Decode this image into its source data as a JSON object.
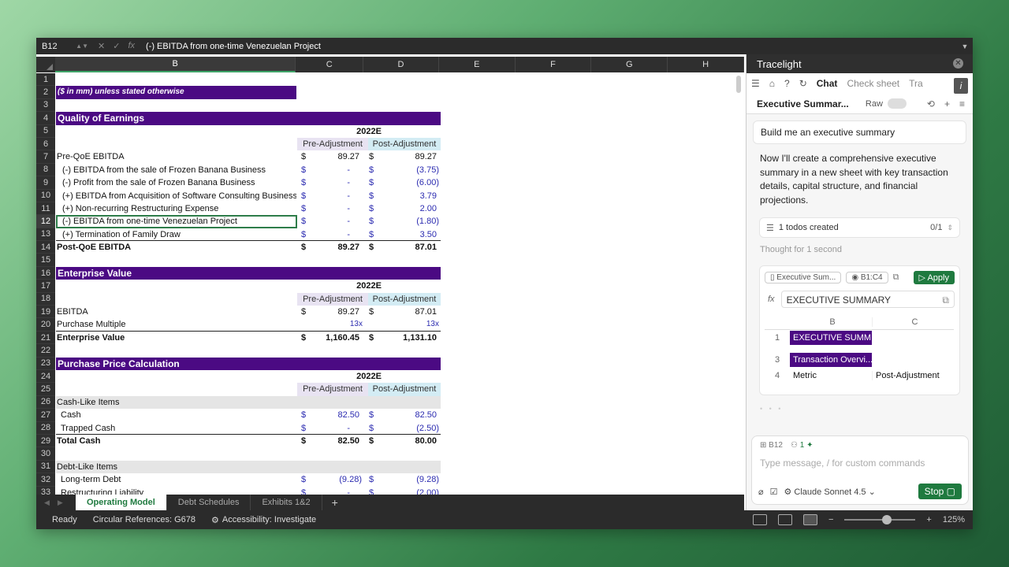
{
  "formula_bar": {
    "name_box": "B12",
    "fx": "fx",
    "formula": "(-) EBITDA from one-time Venezuelan Project"
  },
  "columns": [
    "B",
    "C",
    "D",
    "E",
    "F",
    "G",
    "H"
  ],
  "rows": {
    "r2": "($ in mm) unless stated otherwise",
    "r4": "Quality of Earnings",
    "r5_year": "2022E",
    "r6_pre": "Pre-Adjustment",
    "r6_post": "Post-Adjustment",
    "r7": [
      "Pre-QoE EBITDA",
      "$",
      "89.27",
      "$",
      "89.27"
    ],
    "r8": [
      "(-) EBITDA from the sale of Frozen Banana Business",
      "$",
      "-",
      "$",
      "(3.75)"
    ],
    "r9": [
      "(-) Profit from the sale of Frozen Banana Business",
      "$",
      "-",
      "$",
      "(6.00)"
    ],
    "r10": [
      "(+) EBITDA from Acquisition of Software Consulting Business",
      "$",
      "-",
      "$",
      "3.79"
    ],
    "r11": [
      "(+) Non-recurring Restructuring Expense",
      "$",
      "-",
      "$",
      "2.00"
    ],
    "r12": [
      "(-) EBITDA from one-time Venezuelan Project",
      "$",
      "-",
      "$",
      "(1.80)"
    ],
    "r13": [
      "(+) Termination of Family Draw",
      "$",
      "-",
      "$",
      "3.50"
    ],
    "r14": [
      "Post-QoE EBITDA",
      "$",
      "89.27",
      "$",
      "87.01"
    ],
    "r16": "Enterprise Value",
    "r17_year": "2022E",
    "r18_pre": "Pre-Adjustment",
    "r18_post": "Post-Adjustment",
    "r19": [
      "EBITDA",
      "$",
      "89.27",
      "$",
      "87.01"
    ],
    "r20": [
      "Purchase Multiple",
      "13x",
      "13x"
    ],
    "r21": [
      "Enterprise Value",
      "$",
      "1,160.45",
      "$",
      "1,131.10"
    ],
    "r23": "Purchase Price Calculation",
    "r24_year": "2022E",
    "r25_pre": "Pre-Adjustment",
    "r25_post": "Post-Adjustment",
    "r26": "Cash-Like Items",
    "r27": [
      "Cash",
      "$",
      "82.50",
      "$",
      "82.50"
    ],
    "r28": [
      "Trapped Cash",
      "$",
      "-",
      "$",
      "(2.50)"
    ],
    "r29": [
      "Total Cash",
      "$",
      "82.50",
      "$",
      "80.00"
    ],
    "r31": "Debt-Like Items",
    "r32": [
      "Long-term Debt",
      "$",
      "(9.28)",
      "$",
      "(9.28)"
    ],
    "r33": [
      "Restructuring Liability",
      "$",
      "-",
      "$",
      "(2.00)"
    ]
  },
  "tabs": [
    "Operating Model",
    "Debt Schedules",
    "Exhibits 1&2"
  ],
  "tab_add": "+",
  "status": {
    "ready": "Ready",
    "circular": "Circular References: G678",
    "accessibility": "Accessibility: Investigate",
    "zoom": "125%"
  },
  "panel": {
    "title": "Tracelight",
    "tabs": [
      "Chat",
      "Check sheet",
      "Tra"
    ],
    "conversation_title": "Executive Summar...",
    "raw_label": "Raw",
    "user_message": "Build me an executive summary",
    "assistant_message": "Now I'll create a comprehensive executive summary in a new sheet with key transaction details, capital structure, and financial projections.",
    "todos_label": "1 todos created",
    "todos_count": "0/1",
    "thought": "Thought for 1 second",
    "card": {
      "sheet_chip": "Executive Sum...",
      "range_chip": "B1:C4",
      "apply": "Apply",
      "fx_label": "fx",
      "fx_value": "EXECUTIVE SUMMARY",
      "col_b": "B",
      "col_c": "C",
      "rows": [
        {
          "n": "1",
          "b": "EXECUTIVE SUMM...",
          "c": ""
        },
        {
          "n": "3",
          "b": "Transaction Overvi...",
          "c": ""
        },
        {
          "n": "4",
          "b": "Metric",
          "c": "Post-Adjustment"
        }
      ]
    },
    "composer": {
      "ref": "B12",
      "count": "1",
      "placeholder": "Type message, / for custom commands",
      "model": "Claude Sonnet 4.5",
      "stop": "Stop"
    }
  }
}
